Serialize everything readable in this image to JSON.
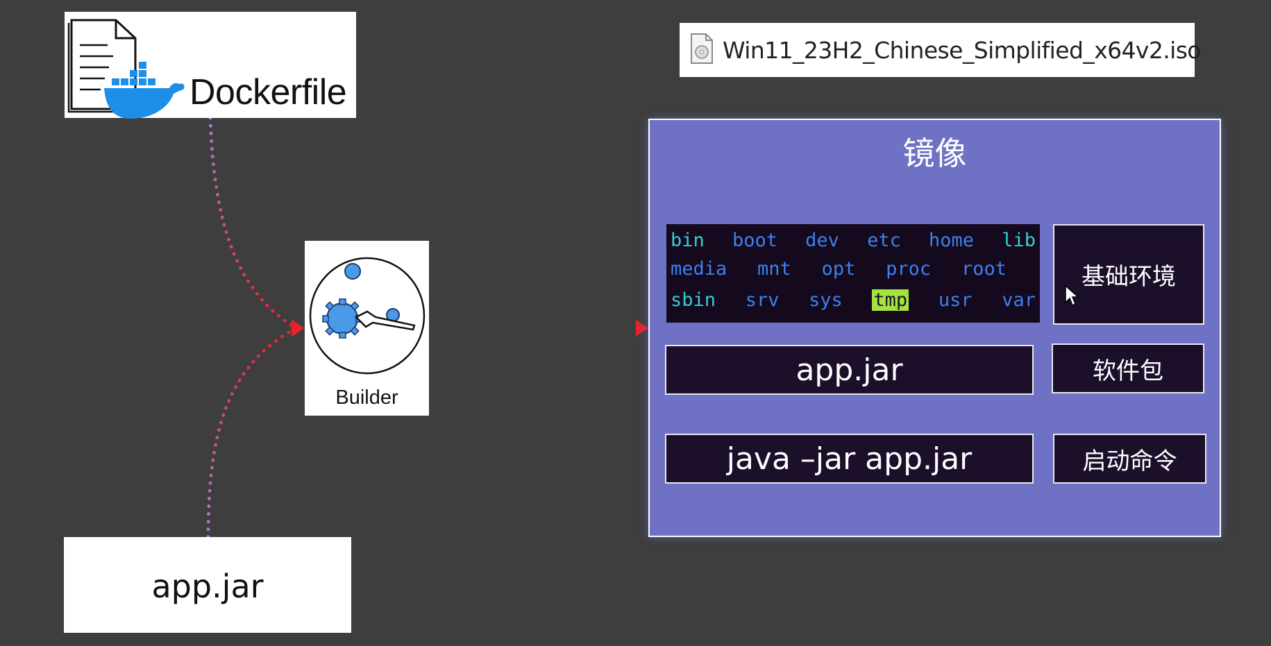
{
  "dockerfile": {
    "label": "Dockerfile"
  },
  "app_source": {
    "label": "app.jar"
  },
  "builder": {
    "label": "Builder"
  },
  "iso_file": {
    "name": "Win11_23H2_Chinese_Simplified_x64v2.iso"
  },
  "image": {
    "title": "镜像",
    "filesystem": {
      "row1": [
        {
          "name": "bin",
          "color": "cyan"
        },
        {
          "name": "boot",
          "color": "blue"
        },
        {
          "name": "dev",
          "color": "blue"
        },
        {
          "name": "etc",
          "color": "blue"
        },
        {
          "name": "home",
          "color": "blue"
        },
        {
          "name": "lib",
          "color": "cyan"
        }
      ],
      "row2": [
        {
          "name": "media",
          "color": "blue"
        },
        {
          "name": "mnt",
          "color": "blue"
        },
        {
          "name": "opt",
          "color": "blue"
        },
        {
          "name": "proc",
          "color": "blue"
        },
        {
          "name": "root",
          "color": "blue"
        }
      ],
      "row3": [
        {
          "name": "sbin",
          "color": "cyan"
        },
        {
          "name": "srv",
          "color": "blue"
        },
        {
          "name": "sys",
          "color": "blue"
        },
        {
          "name": "tmp",
          "color": "highlight"
        },
        {
          "name": "usr",
          "color": "blue"
        },
        {
          "name": "var",
          "color": "blue"
        }
      ]
    },
    "base_env_label": "基础环境",
    "app_jar": "app.jar",
    "package_label": "软件包",
    "command": "java –jar app.jar",
    "command_label": "启动命令"
  },
  "colors": {
    "background": "#3e3e3e",
    "image_box": "#6f71c4",
    "dark_box": "#1c0f2a",
    "cyan": "#33d0d6",
    "blue": "#3b82ef",
    "highlight": "#a6e23e",
    "arrow_red": "#e8232e",
    "arrow_purple": "#a57fcf"
  }
}
